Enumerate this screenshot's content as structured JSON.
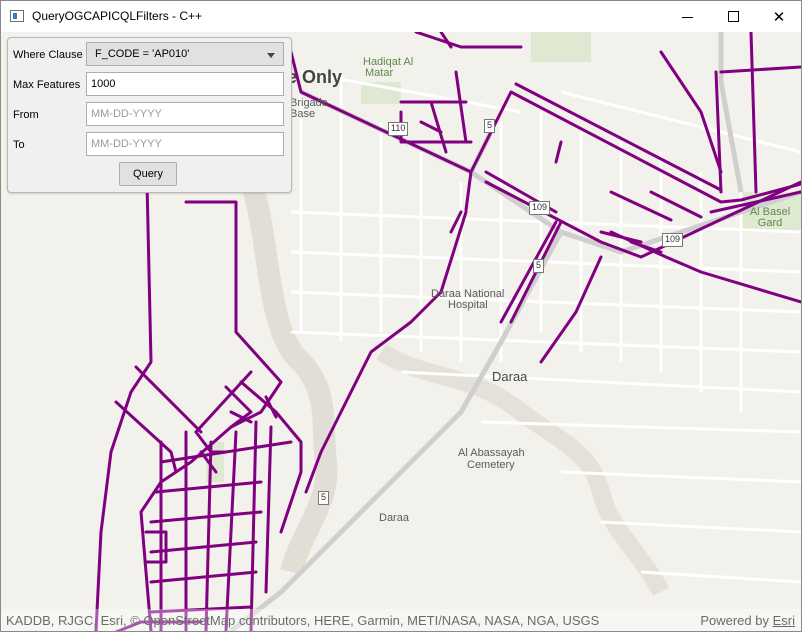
{
  "window": {
    "title": "QueryOGCAPICQLFilters - C++",
    "min_label": "",
    "max_label": "",
    "close_label": "✕"
  },
  "panel": {
    "where_label": "Where Clause",
    "where_value": "F_CODE = 'AP010'",
    "max_label": "Max Features",
    "max_value": "1000",
    "from_label": "From",
    "from_placeholder": "MM-DD-YYYY",
    "to_label": "To",
    "to_placeholder": "MM-DD-YYYY",
    "query_label": "Query"
  },
  "map": {
    "labels": {
      "only": "e Only",
      "hadiqat": "Hadiqat Al",
      "matar": "Matar",
      "brigade": "Brigade",
      "base": "Base",
      "basel": "Al Basel Gard",
      "hospital_1": "Daraa National",
      "hospital_2": "Hospital",
      "daraa_city": "Daraa",
      "abassayah_1": "Al Abassayah",
      "abassayah_2": "Cemetery",
      "daraa_small": "Daraa"
    },
    "shields": {
      "s1": "110",
      "s2": "5",
      "s3": "109",
      "s4": "5",
      "s5": "109",
      "s6": "5"
    },
    "road_color": "#800080"
  },
  "attribution": {
    "left": "KADDB, RJGC, Esri, © OpenStreetMap contributors, HERE, Garmin, METI/NASA, NASA, NGA, USGS",
    "powered": "Powered by",
    "esri": "Esri"
  }
}
